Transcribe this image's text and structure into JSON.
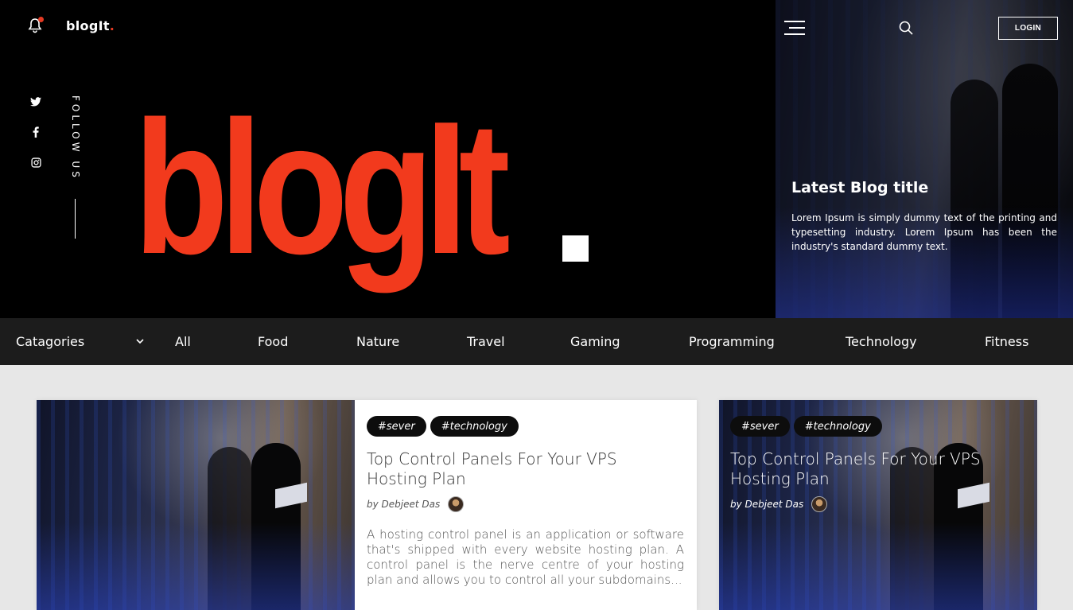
{
  "brand": {
    "name": "blogIt",
    "dot": ".",
    "big_logo": "blogIt"
  },
  "header": {
    "login_label": "LOGIN"
  },
  "social": {
    "follow_label": "FOLLOW US",
    "icons": [
      "twitter-icon",
      "facebook-icon",
      "instagram-icon"
    ]
  },
  "feature": {
    "title": "Latest Blog title",
    "text": "Lorem Ipsum is simply dummy text of the printing and typesetting industry. Lorem Ipsum has been the industry's standard dummy text."
  },
  "categories": {
    "dropdown_label": "Catagories",
    "items": [
      "All",
      "Food",
      "Nature",
      "Travel",
      "Gaming",
      "Programming",
      "Technology",
      "Fitness"
    ]
  },
  "posts": [
    {
      "tags": [
        "#sever",
        "#technology"
      ],
      "title": "Top Control Panels For Your VPS Hosting Plan",
      "author": "by Debjeet Das",
      "excerpt": "A hosting control panel is an application or software that's shipped with every website hosting plan. A control panel is the nerve centre of your hosting plan and allows you to control all your subdomains..."
    },
    {
      "tags": [
        "#sever",
        "#technology"
      ],
      "title": "Top Control Panels For Your VPS Hosting Plan",
      "author": "by Debjeet Das"
    }
  ],
  "colors": {
    "accent": "#f23a1d",
    "bar": "#1c1c1c",
    "background": "#e7e7e7"
  }
}
